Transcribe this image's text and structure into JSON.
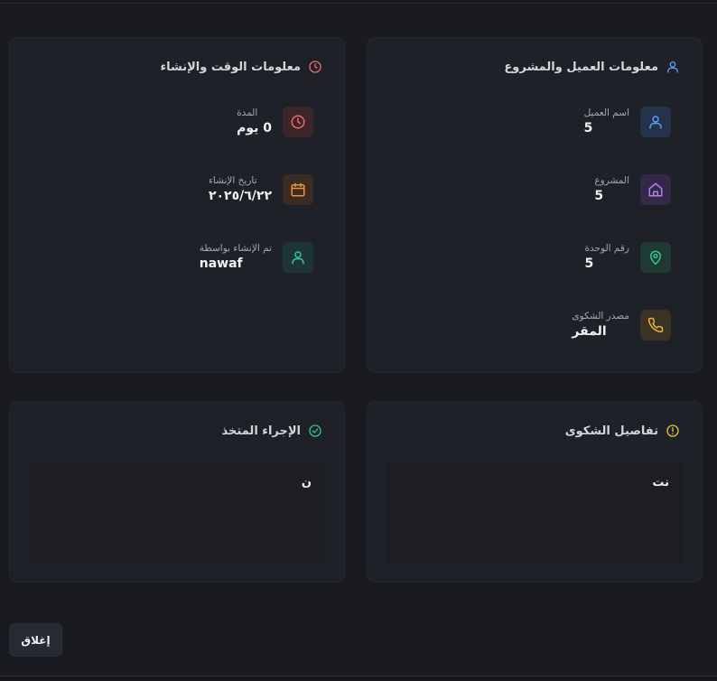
{
  "client_card": {
    "title": "معلومات العميل والمشروع",
    "header_icon": "user-icon",
    "accent": "#5b9cf5",
    "rows": [
      {
        "label": "اسم العميل",
        "value": "5",
        "icon": "user-icon",
        "color": "#5b9cf5",
        "bg": "#25334a"
      },
      {
        "label": "المشروع",
        "value": "5",
        "icon": "home-icon",
        "color": "#b27cf0",
        "bg": "#35294a"
      },
      {
        "label": "رقم الوحدة",
        "value": "5",
        "icon": "map-pin-icon",
        "color": "#33c78f",
        "bg": "#1e3a33"
      },
      {
        "label": "مصدر الشكوى",
        "value": "المقر",
        "icon": "phone-icon",
        "color": "#e8b43a",
        "bg": "#3a3324"
      }
    ]
  },
  "time_card": {
    "title": "معلومات الوقت والإنشاء",
    "header_icon": "clock-icon",
    "accent": "#ef6a6a",
    "rows": [
      {
        "label": "المدة",
        "value": "0 يوم",
        "icon": "clock-icon",
        "color": "#ef6a6a",
        "bg": "#3b2529"
      },
      {
        "label": "تاريخ الإنشاء",
        "value": "٢٠٢٥/٦/٢٢",
        "icon": "calendar-icon",
        "color": "#f0913a",
        "bg": "#3a2c22"
      },
      {
        "label": "تم الإنشاء بواسطة",
        "value": "nawaf",
        "icon": "user-icon",
        "color": "#2fc9a8",
        "bg": "#1e3535"
      }
    ]
  },
  "complaint_details": {
    "title": "تفاصيل الشكوى",
    "header_icon": "alert-circle-icon",
    "accent": "#e8c23a",
    "content": "نت"
  },
  "action_taken": {
    "title": "الإجراء المتخذ",
    "header_icon": "check-circle-icon",
    "accent": "#33c78f",
    "content": "ن"
  },
  "footer": {
    "close_label": "إغلاق"
  }
}
